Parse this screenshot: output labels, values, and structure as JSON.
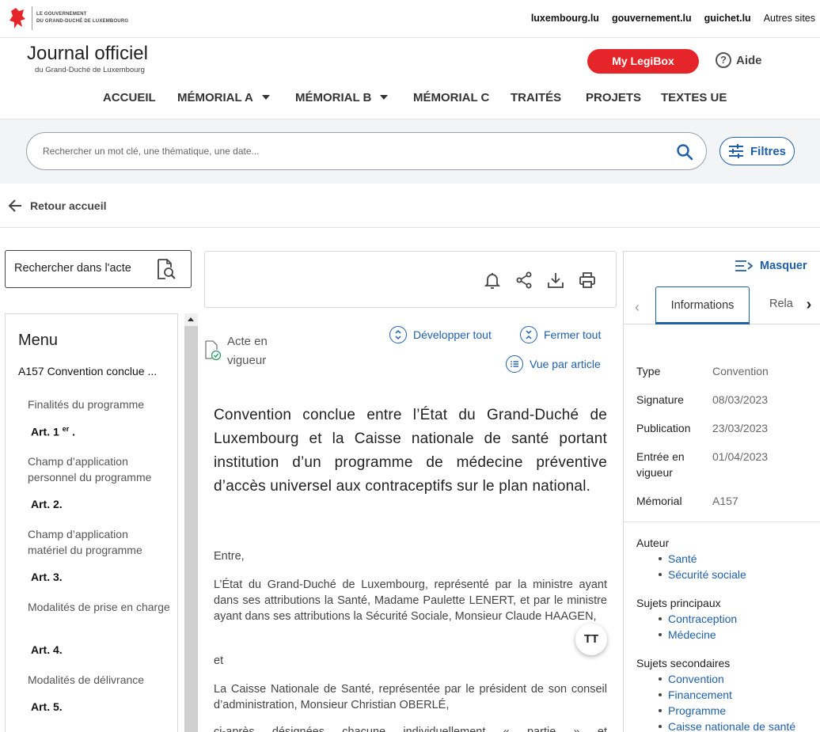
{
  "gov": {
    "logo_line1": "LE GOUVERNEMENT",
    "logo_line2": "DU GRAND-DUCHÉ DE LUXEMBOURG",
    "links": [
      "luxembourg.lu",
      "gouvernement.lu",
      "guichet.lu"
    ],
    "other_sites": "Autres sites"
  },
  "header": {
    "title": "Journal officiel",
    "subtitle": "du Grand-Duché de Luxembourg",
    "legibox": "My LegiBox",
    "aide": "Aide"
  },
  "nav": {
    "accueil": "ACCUEIL",
    "memorial_a": "MÉMORIAL A",
    "memorial_b": "MÉMORIAL B",
    "memorial_c": "MÉMORIAL C",
    "traites": "TRAITÉS",
    "projets": "PROJETS",
    "textes_ue": "TEXTES UE"
  },
  "search": {
    "placeholder": "Rechercher un mot clé, une thématique, une date...",
    "filters_label": "Filtres"
  },
  "back": "Retour accueil",
  "left": {
    "search_in_act": "Rechercher dans l'acte",
    "menu_title": "Menu",
    "doc_ref": "A157 Convention conclue ...",
    "items": {
      "i1": "Finalités du programme",
      "a1_main": "Art. 1",
      "a1_sup": "er",
      "a1_end": ".",
      "i2": "Champ d’application personnel du programme",
      "a2": "Art. 2.",
      "i3": "Champ d’application matériel du programme",
      "a3": "Art. 3.",
      "i4": "Modalités de prise en charge",
      "a4": "Art. 4.",
      "i5": "Modalités de délivrance",
      "a5": "Art. 5."
    }
  },
  "center": {
    "status_line1": "Acte en",
    "status_line2": "vigueur",
    "expand_all": "Développer tout",
    "collapse_all": "Fermer tout",
    "by_article": "Vue par article",
    "title": "Convention conclue entre l’État du Grand-Duché de Luxembourg et la Caisse nationale de santé portant institution d’un programme de médecine préventive d’accès universel aux contraceptifs sur le plan national.",
    "p1": "Entre,",
    "p2": "L’État du Grand-Duché de Luxembourg, représenté par la ministre ayant dans ses attributions la Santé, Madame Paulette LENERT, et par le ministre ayant dans ses attributions la Sécurité Sociale, Monsieur Claude HAAGEN,",
    "p3": "et",
    "p4": "La Caisse Nationale de Santé, représentée par le président de son conseil d’administration, Monsieur Christian OBERLÉ,",
    "p5": "ci-après désignées chacune individuellement « partie » et",
    "fab": "TT"
  },
  "right": {
    "masquer": "Masquer",
    "tab_info": "Informations",
    "tab_rela": "Rela",
    "info": {
      "type_label": "Type",
      "type_value": "Convention",
      "signature_label": "Signature",
      "signature_value": "08/03/2023",
      "publication_label": "Publication",
      "publication_value": "23/03/2023",
      "entree_label": "Entrée en vigueur",
      "entree_value": "01/04/2023",
      "memorial_label": "Mémorial",
      "memorial_value": "A157"
    },
    "auteur": {
      "label": "Auteur",
      "items": [
        "Santé",
        "Sécurité sociale"
      ]
    },
    "sujets_principaux": {
      "label": "Sujets principaux",
      "items": [
        "Contraception",
        "Médecine"
      ]
    },
    "sujets_secondaires": {
      "label": "Sujets secondaires",
      "items": [
        "Convention",
        "Financement",
        "Programme",
        "Caisse nationale de santé"
      ]
    }
  },
  "colors": {
    "accent": "#1f5fa8",
    "legibox": "#e5252a"
  }
}
